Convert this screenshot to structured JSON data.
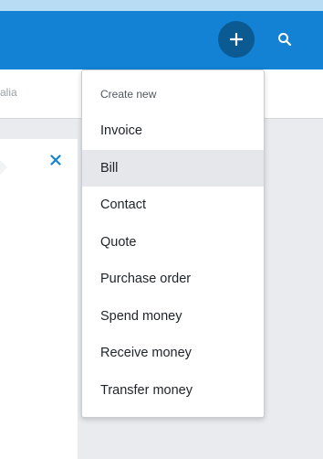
{
  "header": {
    "plus_icon": "plus-icon",
    "search_icon": "search-icon",
    "brand_color": "#1382d4"
  },
  "subbar": {
    "text": "alia"
  },
  "card": {
    "close_icon": "close-icon"
  },
  "menu": {
    "header": "Create new",
    "items": [
      {
        "label": "Invoice",
        "active": false
      },
      {
        "label": "Bill",
        "active": true
      },
      {
        "label": "Contact",
        "active": false
      },
      {
        "label": "Quote",
        "active": false
      },
      {
        "label": "Purchase order",
        "active": false
      },
      {
        "label": "Spend money",
        "active": false
      },
      {
        "label": "Receive money",
        "active": false
      },
      {
        "label": "Transfer money",
        "active": false
      }
    ]
  }
}
